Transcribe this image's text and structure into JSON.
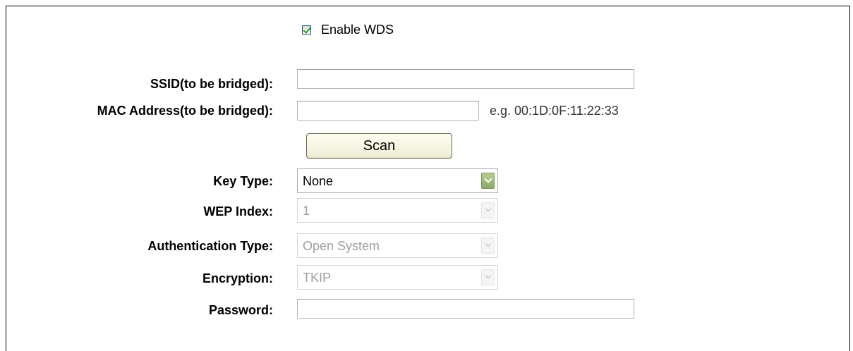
{
  "wds": {
    "enable_label": "Enable WDS",
    "enabled": true
  },
  "fields": {
    "ssid_label": "SSID(to be bridged):",
    "ssid_value": "",
    "mac_label": "MAC Address(to be bridged):",
    "mac_value": "",
    "mac_hint": "e.g. 00:1D:0F:11:22:33",
    "scan_label": "Scan",
    "key_type_label": "Key Type:",
    "key_type_value": "None",
    "wep_index_label": "WEP Index:",
    "wep_index_value": "1",
    "auth_type_label": "Authentication Type:",
    "auth_type_value": "Open System",
    "encryption_label": "Encryption:",
    "encryption_value": "TKIP",
    "password_label": "Password:",
    "password_value": ""
  },
  "icons": {
    "checkbox": "checkmark-icon",
    "select_arrow": "chevron-down-icon"
  },
  "colors": {
    "checkmark": "#21a121",
    "scan_button_bg": "#f0eed7",
    "select_arrow_enabled": "#8aa86a",
    "disabled_text": "#a0a0a0"
  }
}
